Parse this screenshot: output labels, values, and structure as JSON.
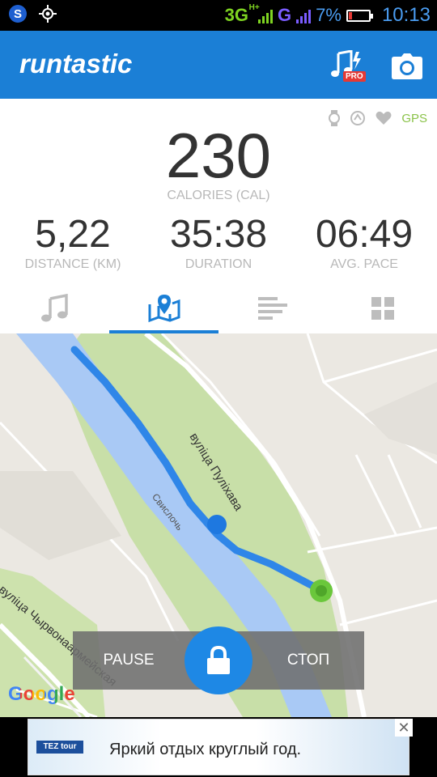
{
  "status_bar": {
    "network": "3G",
    "network_sup": "H+",
    "network2": "G",
    "battery_percent": "7%",
    "time": "10:13"
  },
  "app_bar": {
    "logo": "runtastic",
    "pro_badge": "PRO"
  },
  "status_icons": {
    "gps": "GPS"
  },
  "calories": {
    "value": "230",
    "label": "CALORIES (CAL)"
  },
  "metrics": [
    {
      "value": "5,22",
      "label": "DISTANCE (KM)"
    },
    {
      "value": "35:38",
      "label": "DURATION"
    },
    {
      "value": "06:49",
      "label": "AVG. PACE"
    }
  ],
  "tabs": {
    "items": [
      "music-icon",
      "map-icon",
      "splits-icon",
      "dashboard-icon"
    ],
    "active_index": 1
  },
  "map": {
    "street_1": "вуліца Пуліхава",
    "river": "Свислочь",
    "street_2": "вуліца Чырвонаармейская",
    "google": "Google"
  },
  "controls": {
    "pause": "PAUSE",
    "stop": "СТОП"
  },
  "ad": {
    "logo": "TEZ tour",
    "text": "Яркий отдых круглый год.",
    "close": "✕"
  },
  "colors": {
    "brand_blue": "#1b7fd6",
    "route": "#2f86e8",
    "gps_green": "#8bc34a",
    "marker_end": "#6ac73b"
  }
}
